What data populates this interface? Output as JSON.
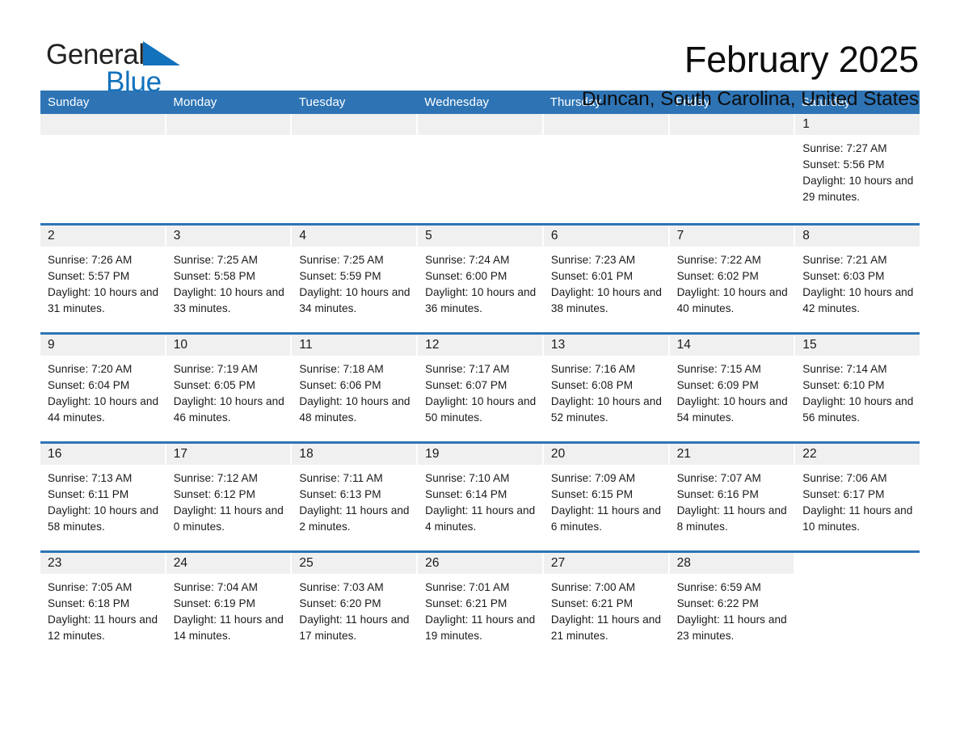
{
  "brand": {
    "name_part1": "General",
    "name_part2": "Blue",
    "triangle_color": "#1272bc"
  },
  "header": {
    "title": "February 2025",
    "location": "Duncan, South Carolina, United States"
  },
  "theme": {
    "accent_blue": "#2e74b5",
    "day_header_bg": "#f0f0f0",
    "text_color": "#1a1a1a"
  },
  "weekdays": [
    "Sunday",
    "Monday",
    "Tuesday",
    "Wednesday",
    "Thursday",
    "Friday",
    "Saturday"
  ],
  "labels": {
    "sunrise_prefix": "Sunrise:",
    "sunset_prefix": "Sunset:",
    "daylight_prefix": "Daylight:"
  },
  "weeks": [
    [
      {
        "day": "",
        "blank": true
      },
      {
        "day": "",
        "blank": true
      },
      {
        "day": "",
        "blank": true
      },
      {
        "day": "",
        "blank": true
      },
      {
        "day": "",
        "blank": true
      },
      {
        "day": "",
        "blank": true
      },
      {
        "day": "1",
        "sunrise": "Sunrise: 7:27 AM",
        "sunset": "Sunset: 5:56 PM",
        "daylight": "Daylight: 10 hours and 29 minutes."
      }
    ],
    [
      {
        "day": "2",
        "sunrise": "Sunrise: 7:26 AM",
        "sunset": "Sunset: 5:57 PM",
        "daylight": "Daylight: 10 hours and 31 minutes."
      },
      {
        "day": "3",
        "sunrise": "Sunrise: 7:25 AM",
        "sunset": "Sunset: 5:58 PM",
        "daylight": "Daylight: 10 hours and 33 minutes."
      },
      {
        "day": "4",
        "sunrise": "Sunrise: 7:25 AM",
        "sunset": "Sunset: 5:59 PM",
        "daylight": "Daylight: 10 hours and 34 minutes."
      },
      {
        "day": "5",
        "sunrise": "Sunrise: 7:24 AM",
        "sunset": "Sunset: 6:00 PM",
        "daylight": "Daylight: 10 hours and 36 minutes."
      },
      {
        "day": "6",
        "sunrise": "Sunrise: 7:23 AM",
        "sunset": "Sunset: 6:01 PM",
        "daylight": "Daylight: 10 hours and 38 minutes."
      },
      {
        "day": "7",
        "sunrise": "Sunrise: 7:22 AM",
        "sunset": "Sunset: 6:02 PM",
        "daylight": "Daylight: 10 hours and 40 minutes."
      },
      {
        "day": "8",
        "sunrise": "Sunrise: 7:21 AM",
        "sunset": "Sunset: 6:03 PM",
        "daylight": "Daylight: 10 hours and 42 minutes."
      }
    ],
    [
      {
        "day": "9",
        "sunrise": "Sunrise: 7:20 AM",
        "sunset": "Sunset: 6:04 PM",
        "daylight": "Daylight: 10 hours and 44 minutes."
      },
      {
        "day": "10",
        "sunrise": "Sunrise: 7:19 AM",
        "sunset": "Sunset: 6:05 PM",
        "daylight": "Daylight: 10 hours and 46 minutes."
      },
      {
        "day": "11",
        "sunrise": "Sunrise: 7:18 AM",
        "sunset": "Sunset: 6:06 PM",
        "daylight": "Daylight: 10 hours and 48 minutes."
      },
      {
        "day": "12",
        "sunrise": "Sunrise: 7:17 AM",
        "sunset": "Sunset: 6:07 PM",
        "daylight": "Daylight: 10 hours and 50 minutes."
      },
      {
        "day": "13",
        "sunrise": "Sunrise: 7:16 AM",
        "sunset": "Sunset: 6:08 PM",
        "daylight": "Daylight: 10 hours and 52 minutes."
      },
      {
        "day": "14",
        "sunrise": "Sunrise: 7:15 AM",
        "sunset": "Sunset: 6:09 PM",
        "daylight": "Daylight: 10 hours and 54 minutes."
      },
      {
        "day": "15",
        "sunrise": "Sunrise: 7:14 AM",
        "sunset": "Sunset: 6:10 PM",
        "daylight": "Daylight: 10 hours and 56 minutes."
      }
    ],
    [
      {
        "day": "16",
        "sunrise": "Sunrise: 7:13 AM",
        "sunset": "Sunset: 6:11 PM",
        "daylight": "Daylight: 10 hours and 58 minutes."
      },
      {
        "day": "17",
        "sunrise": "Sunrise: 7:12 AM",
        "sunset": "Sunset: 6:12 PM",
        "daylight": "Daylight: 11 hours and 0 minutes."
      },
      {
        "day": "18",
        "sunrise": "Sunrise: 7:11 AM",
        "sunset": "Sunset: 6:13 PM",
        "daylight": "Daylight: 11 hours and 2 minutes."
      },
      {
        "day": "19",
        "sunrise": "Sunrise: 7:10 AM",
        "sunset": "Sunset: 6:14 PM",
        "daylight": "Daylight: 11 hours and 4 minutes."
      },
      {
        "day": "20",
        "sunrise": "Sunrise: 7:09 AM",
        "sunset": "Sunset: 6:15 PM",
        "daylight": "Daylight: 11 hours and 6 minutes."
      },
      {
        "day": "21",
        "sunrise": "Sunrise: 7:07 AM",
        "sunset": "Sunset: 6:16 PM",
        "daylight": "Daylight: 11 hours and 8 minutes."
      },
      {
        "day": "22",
        "sunrise": "Sunrise: 7:06 AM",
        "sunset": "Sunset: 6:17 PM",
        "daylight": "Daylight: 11 hours and 10 minutes."
      }
    ],
    [
      {
        "day": "23",
        "sunrise": "Sunrise: 7:05 AM",
        "sunset": "Sunset: 6:18 PM",
        "daylight": "Daylight: 11 hours and 12 minutes."
      },
      {
        "day": "24",
        "sunrise": "Sunrise: 7:04 AM",
        "sunset": "Sunset: 6:19 PM",
        "daylight": "Daylight: 11 hours and 14 minutes."
      },
      {
        "day": "25",
        "sunrise": "Sunrise: 7:03 AM",
        "sunset": "Sunset: 6:20 PM",
        "daylight": "Daylight: 11 hours and 17 minutes."
      },
      {
        "day": "26",
        "sunrise": "Sunrise: 7:01 AM",
        "sunset": "Sunset: 6:21 PM",
        "daylight": "Daylight: 11 hours and 19 minutes."
      },
      {
        "day": "27",
        "sunrise": "Sunrise: 7:00 AM",
        "sunset": "Sunset: 6:21 PM",
        "daylight": "Daylight: 11 hours and 21 minutes."
      },
      {
        "day": "28",
        "sunrise": "Sunrise: 6:59 AM",
        "sunset": "Sunset: 6:22 PM",
        "daylight": "Daylight: 11 hours and 23 minutes."
      },
      {
        "day": "",
        "blank": true,
        "trailing": true
      }
    ]
  ]
}
